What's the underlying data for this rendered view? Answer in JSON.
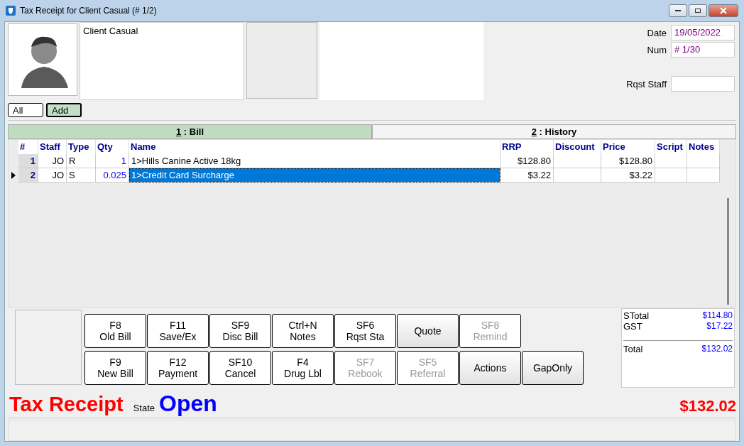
{
  "window": {
    "title": "Tax Receipt for Client Casual (# 1/2)"
  },
  "client": {
    "name": "Client Casual"
  },
  "fields": [
    {
      "label": "Date",
      "value": "19/05/2022"
    },
    {
      "label": "Num",
      "value": "# 1/30"
    },
    {
      "label": "Rqst Staff"
    }
  ],
  "filters": [
    {
      "label": "All",
      "selected": false
    },
    {
      "label": "Add",
      "selected": true
    }
  ],
  "tabs": [
    {
      "key": "1",
      "label": " : Bill",
      "selected": true
    },
    {
      "key": "2",
      "label": " : History",
      "selected": false
    }
  ],
  "table": {
    "columns": [
      "#",
      "Staff",
      "Type",
      "Qty",
      "Name",
      "RRP",
      "Discount",
      "Price",
      "Script",
      "Notes"
    ],
    "rows": [
      {
        "cells": [
          "1",
          "JO",
          "R",
          "1",
          "1>Hills Canine Active 18kg",
          "$128.80",
          "",
          "$128.80",
          "",
          ""
        ],
        "selected": false
      },
      {
        "cells": [
          "2",
          "JO",
          "S",
          "0.025",
          "1>Credit Card Surcharge",
          "$3.22",
          "",
          "$3.22",
          "",
          ""
        ],
        "selected": true
      }
    ]
  },
  "buttons": [
    [
      {
        "key": "F8",
        "label": "Old Bill",
        "disabled": false
      },
      {
        "key": "F11",
        "label": "Save/Ex",
        "disabled": false
      },
      {
        "key": "SF9",
        "label": "Disc Bill",
        "disabled": false
      },
      {
        "key": "Ctrl+N",
        "label": "Notes",
        "disabled": false
      },
      {
        "key": "SF6",
        "label": "Rqst Sta",
        "disabled": false
      },
      {
        "label": "Quote",
        "disabled": false
      },
      {
        "key": "SF8",
        "label": "Remind",
        "disabled": true
      }
    ],
    [
      {
        "key": "F9",
        "label": "New Bill",
        "disabled": false
      },
      {
        "key": "F12",
        "label": "Payment",
        "disabled": false
      },
      {
        "key": "SF10",
        "label": "Cancel",
        "disabled": false
      },
      {
        "key": "F4",
        "label": "Drug Lbl",
        "disabled": false
      },
      {
        "key": "SF7",
        "label": "Rebook",
        "disabled": true
      },
      {
        "key": "SF5",
        "label": "Referral",
        "disabled": true
      },
      {
        "label": "Actions",
        "disabled": false
      },
      {
        "label": "GapOnly",
        "disabled": false
      }
    ]
  ],
  "totals": [
    {
      "label": "STotal",
      "value": "$114.80"
    },
    {
      "label": "GST",
      "value": "$17.22"
    },
    {
      "label": "Total",
      "value": "$132.02"
    }
  ],
  "footer": {
    "document": "Tax Receipt",
    "state_label": "State",
    "state": "Open",
    "amount": "$132.02"
  }
}
